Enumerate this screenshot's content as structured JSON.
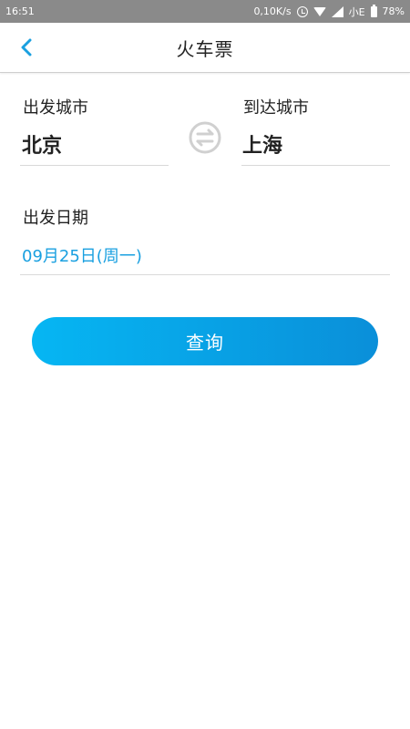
{
  "status_bar": {
    "time": "16:51",
    "network_speed": "0,10K/s",
    "carrier": "小E",
    "battery": "78%"
  },
  "header": {
    "title": "火车票",
    "back_icon": "chevron-left-icon"
  },
  "departure": {
    "label": "出发城市",
    "value": "北京"
  },
  "arrival": {
    "label": "到达城市",
    "value": "上海"
  },
  "swap_icon": "swap-arrows-icon",
  "date": {
    "label": "出发日期",
    "value": "09月25日(周一)"
  },
  "query_button": {
    "label": "查询"
  },
  "colors": {
    "accent": "#1aa0e0",
    "button_gradient_start": "#06b6f3",
    "button_gradient_end": "#0a8fd9",
    "status_bar": "#8a8a8a"
  }
}
